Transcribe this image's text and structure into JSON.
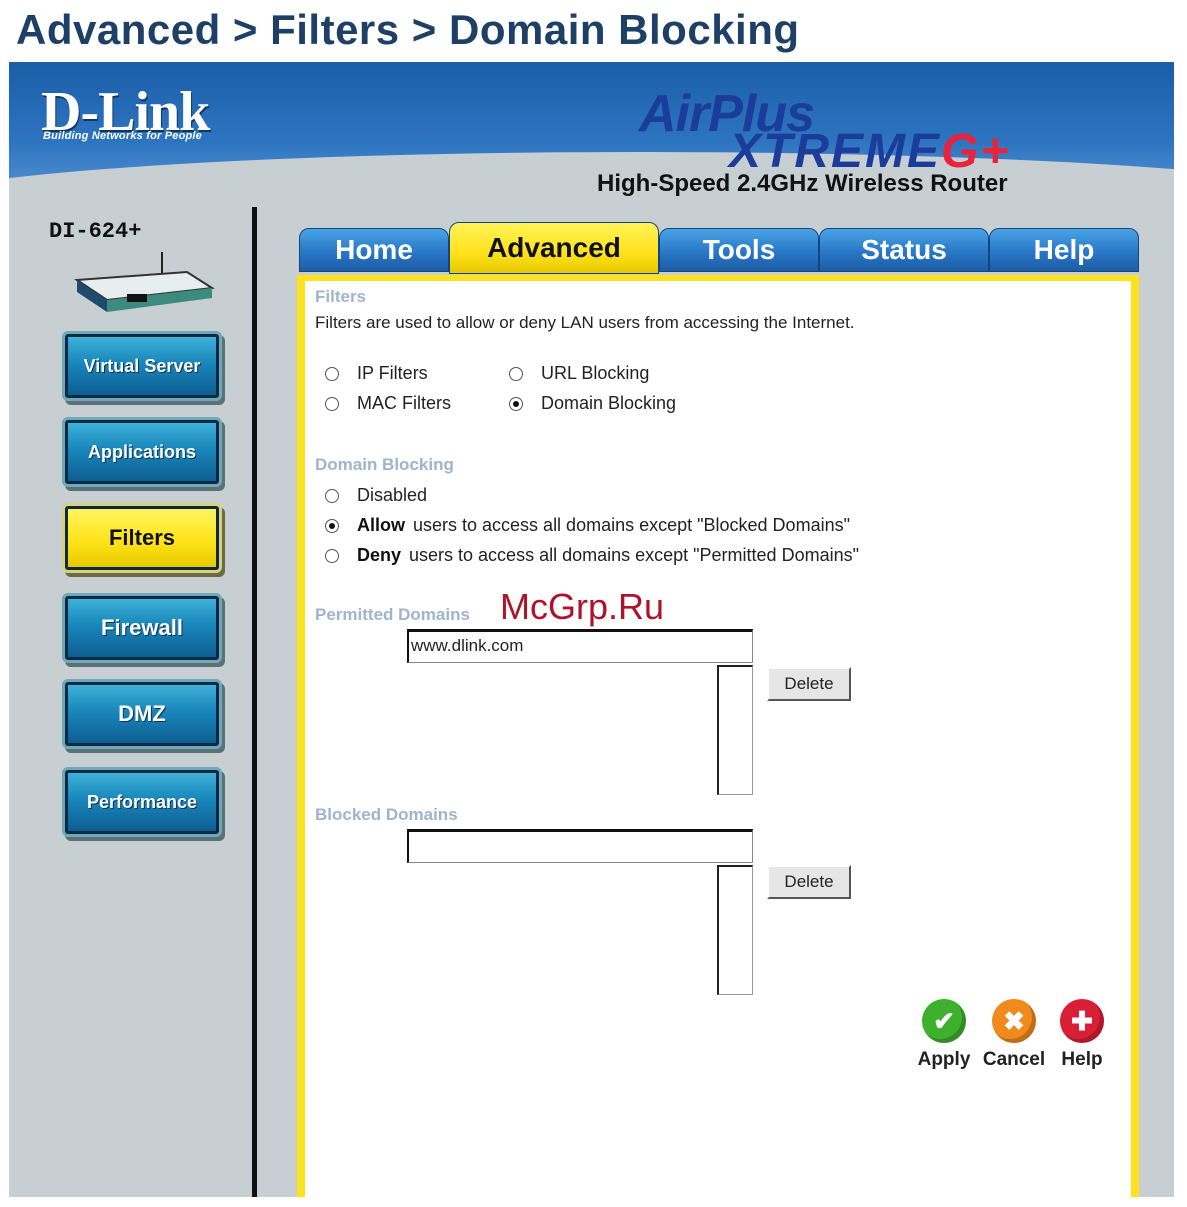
{
  "heading": "Advanced > Filters > Domain Blocking",
  "banner": {
    "brand": "D-Link",
    "brand_tagline": "Building Networks for People",
    "product_line_1": "AirPlus",
    "product_line_2": "XtremeG+",
    "product_desc": "High-Speed 2.4GHz Wireless Router"
  },
  "model": "DI-624+",
  "sidebar": {
    "items": [
      {
        "label": "Virtual Server"
      },
      {
        "label": "Applications"
      },
      {
        "label": "Filters"
      },
      {
        "label": "Firewall"
      },
      {
        "label": "DMZ"
      },
      {
        "label": "Performance"
      }
    ],
    "active": "Filters"
  },
  "tabs": [
    {
      "label": "Home"
    },
    {
      "label": "Advanced"
    },
    {
      "label": "Tools"
    },
    {
      "label": "Status"
    },
    {
      "label": "Help"
    }
  ],
  "filters": {
    "title": "Filters",
    "description": "Filters are used to allow or deny LAN users from accessing the Internet.",
    "options": {
      "ip": "IP Filters",
      "url": "URL Blocking",
      "mac": "MAC Filters",
      "domain": "Domain Blocking"
    },
    "selected": "Domain Blocking"
  },
  "domain_blocking": {
    "title": "Domain Blocking",
    "disabled": "Disabled",
    "allow_bold": "Allow",
    "allow_text": "users to access all domains except \"Blocked Domains\"",
    "deny_bold": "Deny",
    "deny_text": "users to access all domains except \"Permitted Domains\"",
    "selected": "Allow"
  },
  "permitted": {
    "title": "Permitted Domains",
    "input_value": "www.dlink.com",
    "delete_label": "Delete"
  },
  "blocked": {
    "title": "Blocked Domains",
    "input_value": "",
    "delete_label": "Delete"
  },
  "actions": {
    "apply": "Apply",
    "cancel": "Cancel",
    "help": "Help"
  },
  "watermark": "McGrp.Ru",
  "colors": {
    "tab_blue": "#2877c6",
    "active_yellow": "#ffe21b",
    "apply_green": "#3db12c",
    "cancel_orange": "#f08a1c",
    "help_red": "#d91f35"
  }
}
